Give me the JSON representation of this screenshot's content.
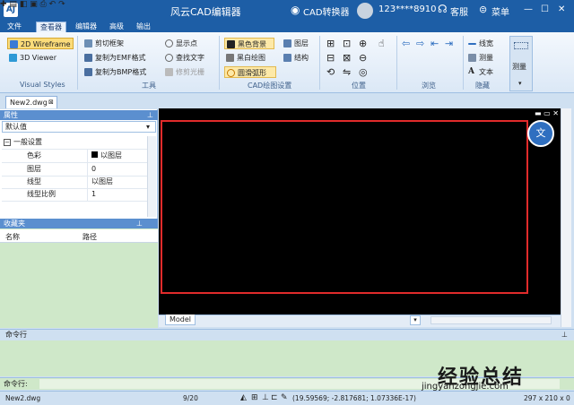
{
  "titlebar": {
    "logo": "AJ",
    "title": "风云CAD编辑器",
    "converter": "CAD转换器",
    "user": "123****8910",
    "service": "客服",
    "menu": "菜单"
  },
  "tabs": [
    "文件",
    "查看器",
    "编辑器",
    "高级",
    "输出"
  ],
  "ribbon": {
    "visual_styles": {
      "btn1": "2D Wireframe",
      "btn2": "3D Viewer",
      "group": "Visual Styles"
    },
    "tools": {
      "clip": "剪切框架",
      "copy_emf": "复制为EMF格式",
      "copy_bmp": "复制为BMP格式",
      "show_points": "显示点",
      "find_text": "查找文字",
      "trim_raster": "修剪光栅",
      "group": "工具"
    },
    "cad_settings": {
      "black_bg": "黑色背景",
      "bw_drawing": "黑白绘图",
      "smooth_arc": "圆滑弧形",
      "layers": "图层",
      "structure": "结构",
      "group": "CAD绘图设置"
    },
    "position": {
      "group": "位置"
    },
    "browse": {
      "group": "浏览"
    },
    "hide": {
      "linewidth": "线宽",
      "measure": "测量",
      "text": "文本",
      "group": "隐藏"
    },
    "measure_big": "测量"
  },
  "doc": {
    "tab": "New2.dwg"
  },
  "properties": {
    "header": "属性",
    "default": "默认值",
    "section": "一般设置",
    "rows": [
      {
        "k": "色彩",
        "v": "以图层"
      },
      {
        "k": "图层",
        "v": "0"
      },
      {
        "k": "线型",
        "v": "以图层"
      },
      {
        "k": "线型比例",
        "v": "1"
      }
    ]
  },
  "favorites": {
    "header": "收藏夹",
    "col_name": "名称",
    "col_path": "路径"
  },
  "canvas": {
    "model_tab": "Model"
  },
  "command": {
    "header": "命令行",
    "prompt": "命令行:"
  },
  "status": {
    "file": "New2.dwg",
    "page": "9/20",
    "coords": "(19.59569; -2.817681; 1.07336E-17)",
    "size": "297 x 210 x 0"
  },
  "watermark": {
    "text": "经验总结",
    "url": "jingyanzongjie.com"
  },
  "colors": {
    "title": "#1d5ea6",
    "accent": "#5b8fcf",
    "frame": "#e12b2b",
    "panel_green": "#cfe8c9"
  }
}
